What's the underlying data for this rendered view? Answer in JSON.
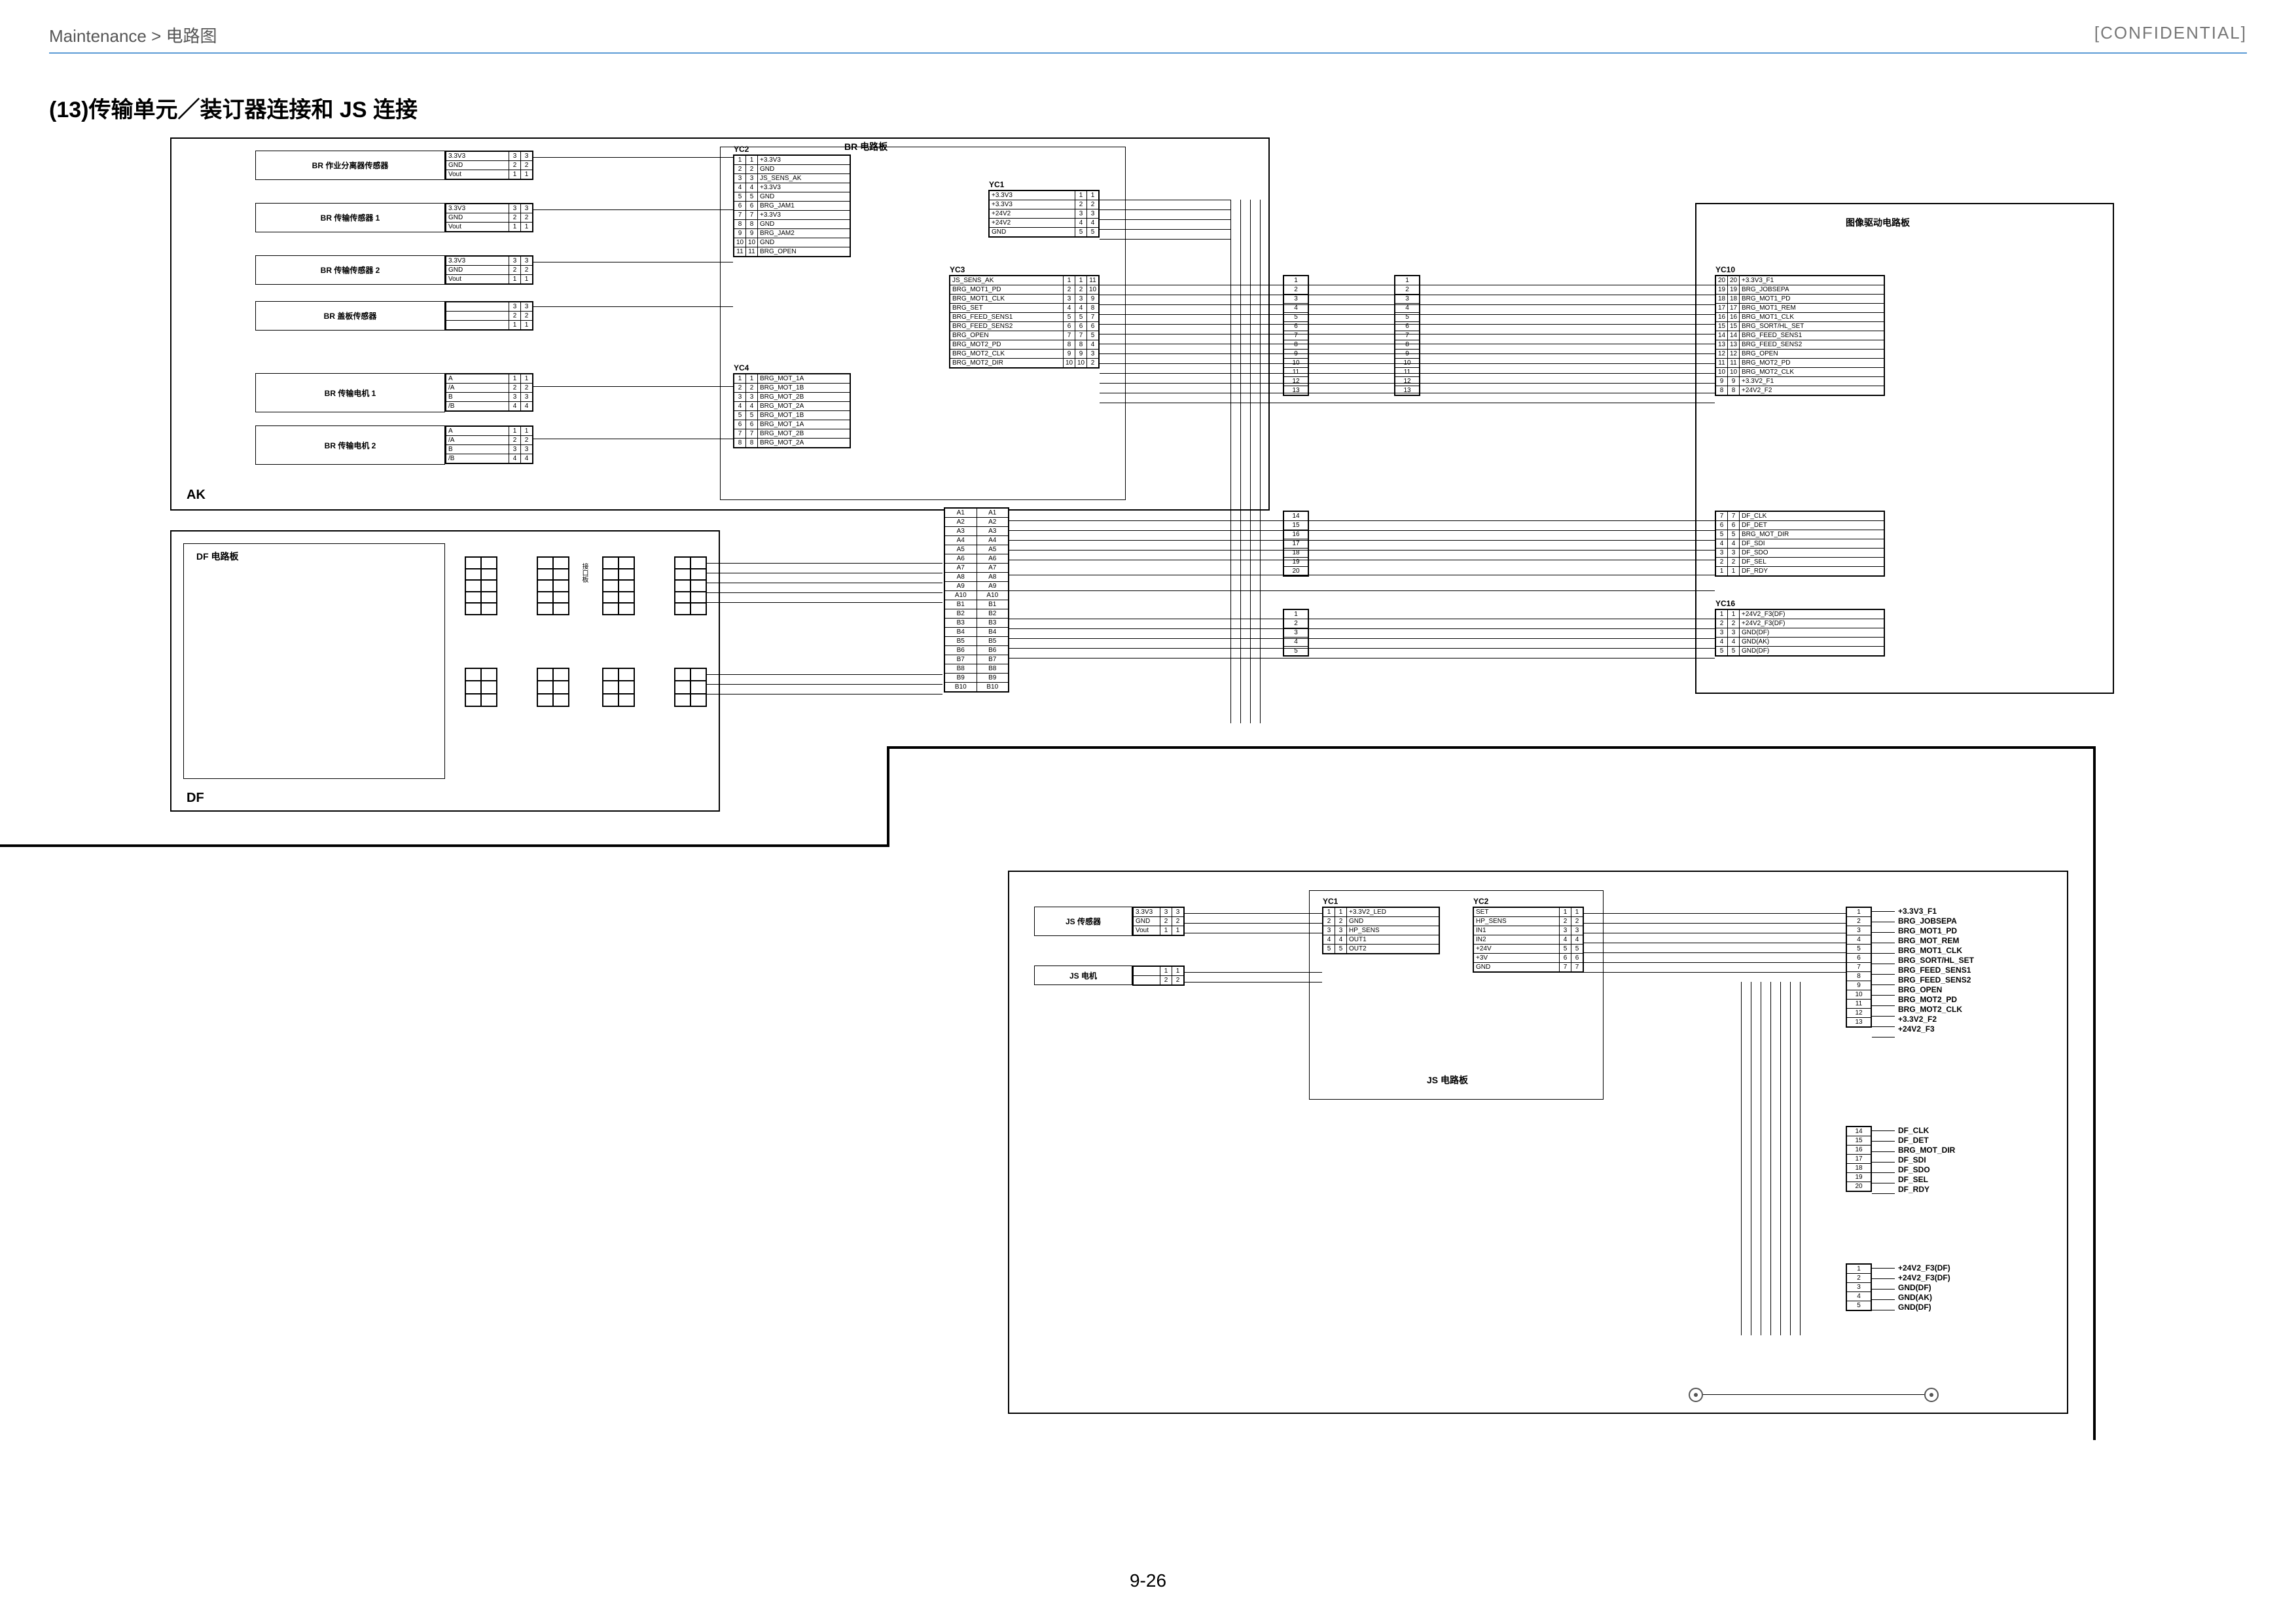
{
  "header": {
    "breadcrumb": "Maintenance > 电路图",
    "confidential": "[CONFIDENTIAL]"
  },
  "title": "(13)传输单元／装订器连接和 JS 连接",
  "page_number": "9-26",
  "ak_panel": {
    "label": "AK",
    "br_label": "BR 电路板",
    "components": [
      {
        "name": "BR 作业分离器传感器",
        "pins": [
          [
            "3.3V3",
            "3",
            "3"
          ],
          [
            "GND",
            "2",
            "2"
          ],
          [
            "Vout",
            "1",
            "1"
          ]
        ]
      },
      {
        "name": "BR 传输传感器 1",
        "pins": [
          [
            "3.3V3",
            "3",
            "3"
          ],
          [
            "GND",
            "2",
            "2"
          ],
          [
            "Vout",
            "1",
            "1"
          ]
        ]
      },
      {
        "name": "BR 传输传感器 2",
        "pins": [
          [
            "3.3V3",
            "3",
            "3"
          ],
          [
            "GND",
            "2",
            "2"
          ],
          [
            "Vout",
            "1",
            "1"
          ]
        ]
      },
      {
        "name": "BR 盖板传感器",
        "pins": [
          [
            "",
            "3",
            "3"
          ],
          [
            "",
            "2",
            "2"
          ],
          [
            "",
            "1",
            "1"
          ]
        ]
      },
      {
        "name": "BR 传输电机 1",
        "pins": [
          [
            "A",
            "1",
            "1"
          ],
          [
            "/A",
            "2",
            "2"
          ],
          [
            "B",
            "3",
            "3"
          ],
          [
            "/B",
            "4",
            "4"
          ]
        ]
      },
      {
        "name": "BR 传输电机 2",
        "pins": [
          [
            "A",
            "1",
            "1"
          ],
          [
            "/A",
            "2",
            "2"
          ],
          [
            "B",
            "3",
            "3"
          ],
          [
            "/B",
            "4",
            "4"
          ]
        ]
      }
    ],
    "yc2": {
      "name": "YC2",
      "rows": [
        [
          "1",
          "1",
          "+3.3V3"
        ],
        [
          "2",
          "2",
          "GND"
        ],
        [
          "3",
          "3",
          "JS_SENS_AK"
        ],
        [
          "4",
          "4",
          "+3.3V3"
        ],
        [
          "5",
          "5",
          "GND"
        ],
        [
          "6",
          "6",
          "BRG_JAM1"
        ],
        [
          "7",
          "7",
          "+3.3V3"
        ],
        [
          "8",
          "8",
          "GND"
        ],
        [
          "9",
          "9",
          "BRG_JAM2"
        ],
        [
          "10",
          "10",
          "GND"
        ],
        [
          "11",
          "11",
          "BRG_OPEN"
        ]
      ]
    },
    "yc4": {
      "name": "YC4",
      "rows": [
        [
          "1",
          "1",
          "BRG_MOT_1A"
        ],
        [
          "2",
          "2",
          "BRG_MOT_1B"
        ],
        [
          "3",
          "3",
          "BRG_MOT_2B"
        ],
        [
          "4",
          "4",
          "BRG_MOT_2A"
        ],
        [
          "5",
          "5",
          "BRG_MOT_1B"
        ],
        [
          "6",
          "6",
          "BRG_MOT_1A"
        ],
        [
          "7",
          "7",
          "BRG_MOT_2B"
        ],
        [
          "8",
          "8",
          "BRG_MOT_2A"
        ]
      ]
    },
    "yc1": {
      "name": "YC1",
      "rows": [
        [
          "+3.3V3",
          "1",
          "1"
        ],
        [
          "+3.3V3",
          "2",
          "2"
        ],
        [
          "+24V2",
          "3",
          "3"
        ],
        [
          "+24V2",
          "4",
          "4"
        ],
        [
          "GND",
          "5",
          "5"
        ]
      ]
    },
    "yc3": {
      "name": "YC3",
      "rows": [
        [
          "JS_SENS_AK",
          "1",
          "1",
          "11"
        ],
        [
          "BRG_MOT1_PD",
          "2",
          "2",
          "10"
        ],
        [
          "BRG_MOT1_CLK",
          "3",
          "3",
          "9"
        ],
        [
          "BRG_SET",
          "4",
          "4",
          "8"
        ],
        [
          "BRG_FEED_SENS1",
          "5",
          "5",
          "7"
        ],
        [
          "BRG_FEED_SENS2",
          "6",
          "6",
          "6"
        ],
        [
          "BRG_OPEN",
          "7",
          "7",
          "5"
        ],
        [
          "BRG_MOT2_PD",
          "8",
          "8",
          "4"
        ],
        [
          "BRG_MOT2_CLK",
          "9",
          "9",
          "3"
        ],
        [
          "BRG_MOT2_DIR",
          "10",
          "10",
          "2"
        ]
      ]
    },
    "yc3_low_pairs": [
      [
        "A1",
        "A1"
      ],
      [
        "A2",
        "A2"
      ],
      [
        "A3",
        "A3"
      ],
      [
        "A4",
        "A4"
      ],
      [
        "A5",
        "A5"
      ],
      [
        "A6",
        "A6"
      ],
      [
        "A7",
        "A7"
      ],
      [
        "A8",
        "A8"
      ],
      [
        "A9",
        "A9"
      ],
      [
        "A10",
        "A10"
      ],
      [
        "B1",
        "B1"
      ],
      [
        "B2",
        "B2"
      ],
      [
        "B3",
        "B3"
      ],
      [
        "B4",
        "B4"
      ],
      [
        "B5",
        "B5"
      ],
      [
        "B6",
        "B6"
      ],
      [
        "B7",
        "B7"
      ],
      [
        "B8",
        "B8"
      ],
      [
        "B9",
        "B9"
      ],
      [
        "B10",
        "B10"
      ]
    ]
  },
  "df_panel": {
    "label": "DF",
    "board_label": "DF 电路板",
    "hub_label": "接口板"
  },
  "image_drive_panel": {
    "title": "图像驱动电路板",
    "yc10": {
      "name": "YC10",
      "left": [
        [
          "1",
          ""
        ],
        [
          "2",
          ""
        ],
        [
          "3",
          ""
        ],
        [
          "4",
          ""
        ],
        [
          "5",
          ""
        ],
        [
          "6",
          ""
        ],
        [
          "7",
          ""
        ],
        [
          "8",
          ""
        ],
        [
          "9",
          ""
        ],
        [
          "10",
          ""
        ],
        [
          "11",
          ""
        ],
        [
          "12",
          ""
        ],
        [
          "13",
          ""
        ]
      ],
      "right": [
        [
          "20",
          "20",
          "+3.3V3_F1"
        ],
        [
          "19",
          "19",
          "BRG_JOBSEPA"
        ],
        [
          "18",
          "18",
          "BRG_MOT1_PD"
        ],
        [
          "17",
          "17",
          "BRG_MOT1_REM"
        ],
        [
          "16",
          "16",
          "BRG_MOT1_CLK"
        ],
        [
          "15",
          "15",
          "BRG_SORT/HL_SET"
        ],
        [
          "14",
          "14",
          "BRG_FEED_SENS1"
        ],
        [
          "13",
          "13",
          "BRG_FEED_SENS2"
        ],
        [
          "12",
          "12",
          "BRG_OPEN"
        ],
        [
          "11",
          "11",
          "BRG_MOT2_PD"
        ],
        [
          "10",
          "10",
          "BRG_MOT2_CLK"
        ],
        [
          "9",
          "9",
          "+3.3V2_F1"
        ],
        [
          "8",
          "8",
          "+24V2_F2"
        ]
      ],
      "right2": [
        [
          "7",
          "7",
          "DF_CLK"
        ],
        [
          "6",
          "6",
          "DF_DET"
        ],
        [
          "5",
          "5",
          "BRG_MOT_DIR"
        ],
        [
          "4",
          "4",
          "DF_SDI"
        ],
        [
          "3",
          "3",
          "DF_SDO"
        ],
        [
          "2",
          "2",
          "DF_SEL"
        ],
        [
          "1",
          "1",
          "DF_RDY"
        ]
      ]
    },
    "mid_left_numbers": [
      "14",
      "15",
      "16",
      "17",
      "18",
      "19",
      "20"
    ],
    "yc16": {
      "name": "YC16",
      "rows": [
        [
          "1",
          "1",
          "+24V2_F3(DF)"
        ],
        [
          "2",
          "2",
          "+24V2_F3(DF)"
        ],
        [
          "3",
          "3",
          "GND(DF)"
        ],
        [
          "4",
          "4",
          "GND(AK)"
        ],
        [
          "5",
          "5",
          "GND(DF)"
        ]
      ]
    }
  },
  "js_panel": {
    "board_label": "JS 电路板",
    "components": [
      {
        "name": "JS 传感器",
        "pins": [
          [
            "3.3V3",
            "3",
            "3"
          ],
          [
            "GND",
            "2",
            "2"
          ],
          [
            "Vout",
            "1",
            "1"
          ]
        ]
      },
      {
        "name": "JS 电机",
        "pins": [
          [
            "",
            "1",
            "1"
          ],
          [
            "",
            "2",
            "2"
          ]
        ]
      }
    ],
    "yc1": {
      "name": "YC1",
      "rows": [
        [
          "1",
          "1",
          "+3.3V2_LED"
        ],
        [
          "2",
          "2",
          "GND"
        ],
        [
          "3",
          "3",
          "HP_SENS"
        ],
        [
          "4",
          "4",
          "OUT1"
        ],
        [
          "5",
          "5",
          "OUT2"
        ]
      ]
    },
    "yc2": {
      "name": "YC2",
      "rows": [
        [
          "SET",
          "1",
          "1"
        ],
        [
          "HP_SENS",
          "2",
          "2"
        ],
        [
          "IN1",
          "3",
          "3"
        ],
        [
          "IN2",
          "4",
          "4"
        ],
        [
          "+24V",
          "5",
          "5"
        ],
        [
          "+3V",
          "6",
          "6"
        ],
        [
          "GND",
          "7",
          "7"
        ]
      ]
    },
    "right_conn_nums_a": [
      "1",
      "2",
      "3",
      "4",
      "5",
      "6",
      "7",
      "8",
      "9",
      "10",
      "11",
      "12",
      "13"
    ],
    "right_conn_nums_b": [
      "14",
      "15",
      "16",
      "17",
      "18",
      "19",
      "20"
    ],
    "right_conn_nums_c": [
      "1",
      "2",
      "3",
      "4",
      "5"
    ],
    "signals_a": [
      "+3.3V3_F1",
      "BRG_JOBSEPA",
      "BRG_MOT1_PD",
      "BRG_MOT_REM",
      "BRG_MOT1_CLK",
      "BRG_SORT/HL_SET",
      "BRG_FEED_SENS1",
      "BRG_FEED_SENS2",
      "BRG_OPEN",
      "BRG_MOT2_PD",
      "BRG_MOT2_CLK",
      "+3.3V2_F2",
      "+24V2_F3"
    ],
    "signals_b": [
      "DF_CLK",
      "DF_DET",
      "BRG_MOT_DIR",
      "DF_SDI",
      "DF_SDO",
      "DF_SEL",
      "DF_RDY"
    ],
    "signals_c": [
      "+24V2_F3(DF)",
      "+24V2_F3(DF)",
      "GND(DF)",
      "GND(AK)",
      "GND(DF)"
    ]
  }
}
